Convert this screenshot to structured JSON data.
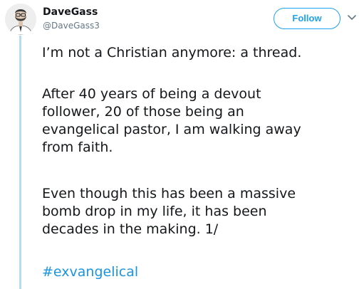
{
  "author": {
    "display_name": "DaveGass",
    "handle": "@DaveGass3",
    "avatar_icon": "bearded-man-avatar-icon"
  },
  "actions": {
    "follow_label": "Follow",
    "menu_icon": "chevron-down-icon"
  },
  "tweet": {
    "paragraph1": [
      "I’m not a Christian anymore: a thread."
    ],
    "paragraph2": [
      "After 40 years of being a devout",
      "follower, 20 of those being an",
      "evangelical pastor, I am walking away",
      "from faith."
    ],
    "paragraph3": [
      "Even though this has been a massive",
      "bomb drop in my life, it has been",
      "decades in the making. 1/"
    ],
    "hashtag": "#exvangelical"
  },
  "colors": {
    "accent": "#1da1f2",
    "hashtag": "#1b95e0",
    "thread_line": "#b3ddf5",
    "text": "#14171a",
    "muted": "#657786"
  }
}
